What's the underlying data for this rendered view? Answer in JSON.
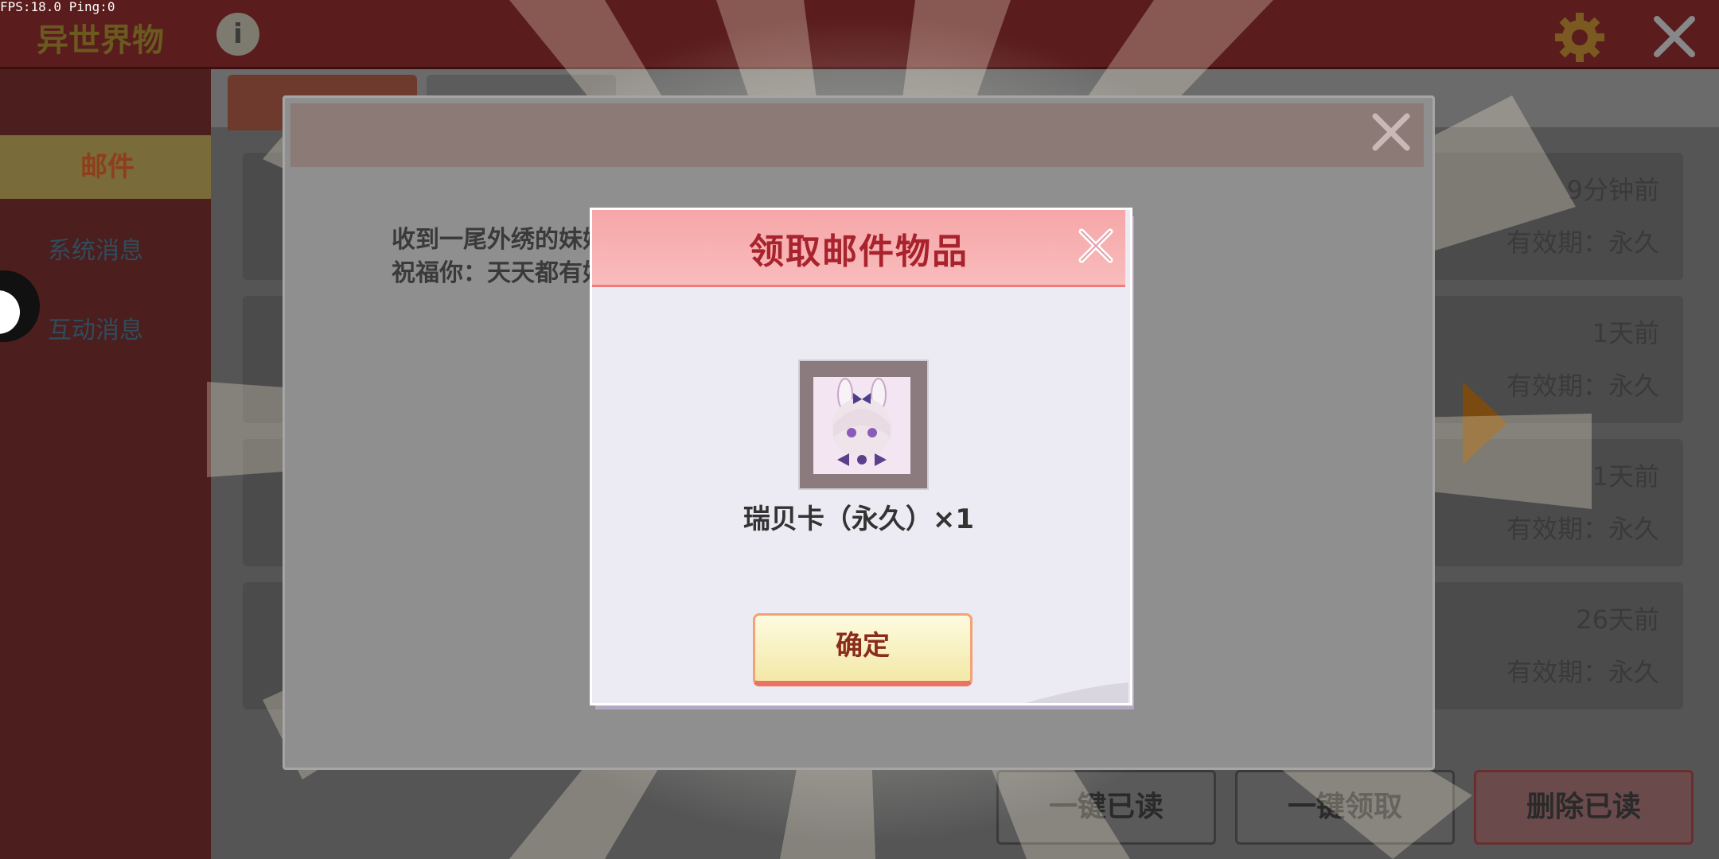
{
  "hud": {
    "fps": "FPS:18.0  Ping:0"
  },
  "header": {
    "title": "异世界物"
  },
  "sidebar": {
    "items": [
      {
        "label": "邮件"
      },
      {
        "label": "系统消息"
      },
      {
        "label": "互动消息"
      }
    ]
  },
  "mail_list": [
    {
      "time": "9分钟前",
      "expiry": "有效期：永久"
    },
    {
      "time": "1天前",
      "expiry": "有效期：永久"
    },
    {
      "time": "1天前",
      "expiry": "有效期：永久"
    },
    {
      "time": "26天前",
      "expiry": "有效期：永久"
    }
  ],
  "mail_detail": {
    "line1": "收到一尾外绣的妹妹",
    "line2": "祝福你：天天都有好"
  },
  "bottom_actions": {
    "read_all": "一键已读",
    "claim_all": "一键领取",
    "delete_read": "删除已读"
  },
  "reward_dialog": {
    "title": "领取邮件物品",
    "item_name": "瑞贝卡（永久）×1",
    "confirm_label": "确定"
  },
  "colors": {
    "accent_red": "#a8232e",
    "dialog_header": "#f6a6a8",
    "button_yellow": "#f3e8a6"
  }
}
